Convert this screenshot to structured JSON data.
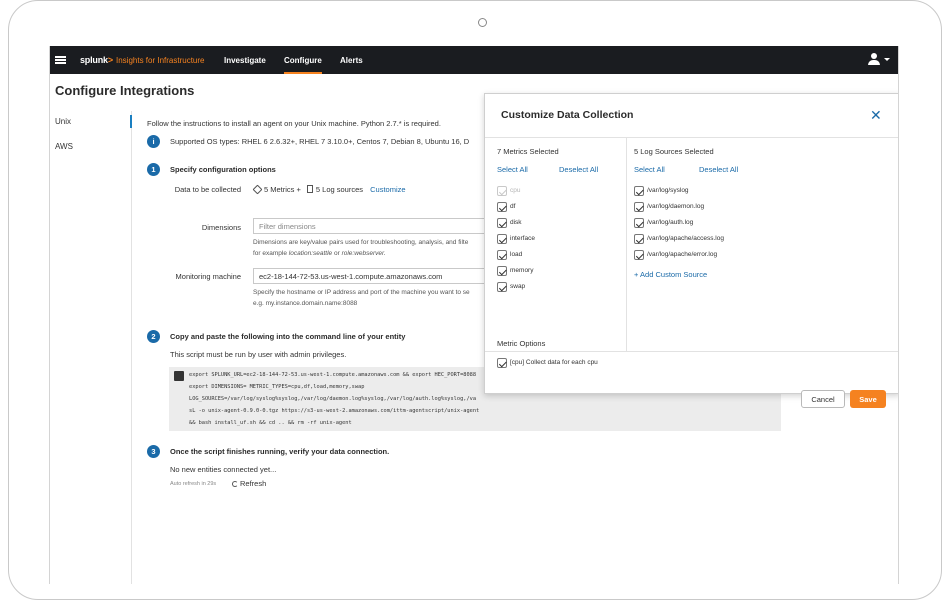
{
  "header": {
    "logo": "splunk",
    "logo_gt": ">",
    "product": "Insights for Infrastructure",
    "nav": [
      {
        "label": "Investigate"
      },
      {
        "label": "Configure"
      },
      {
        "label": "Alerts"
      }
    ],
    "accent": "#f58220"
  },
  "page": {
    "title": "Configure Integrations"
  },
  "sidebar": {
    "items": [
      {
        "label": "Unix"
      },
      {
        "label": "AWS"
      }
    ]
  },
  "main": {
    "instructions": "Follow the instructions to install an agent on your Unix machine. Python 2.7.* is required.",
    "supported": "Supported OS types: RHEL 6 2.6.32+, RHEL 7 3.10.0+, Centos 7, Debian 8, Ubuntu 16, D",
    "step1": {
      "number": "1",
      "title": "Specify configuration options",
      "data_label": "Data to be collected",
      "metrics_summary": "5 Metrics +",
      "logs_summary": "5 Log sources",
      "customize": "Customize",
      "dimensions_label": "Dimensions",
      "dimensions_placeholder": "Filter dimensions",
      "dimensions_help1": "Dimensions are key/value pairs used for troubleshooting, analysis, and filte",
      "dimensions_help2_prefix": "for example ",
      "dimensions_help2_ex1": "location:seattle",
      "dimensions_help2_or": " or ",
      "dimensions_help2_ex2": "role:webserver.",
      "monitoring_label": "Monitoring machine",
      "monitoring_value": "ec2-18-144-72-53.us-west-1.compute.amazonaws.com",
      "monitoring_help1": "Specify the hostname or IP address and port of the machine you want to se",
      "monitoring_help2": "e.g. my.instance.domain.name:8088"
    },
    "step2": {
      "number": "2",
      "title": "Copy and paste the following into the command line of your entity",
      "note": "This script must be run by user with admin privileges.",
      "code": [
        "export SPLUNK_URL=ec2-18-144-72-53.us-west-1.compute.amazonaws.com && export HEC_PORT=8088",
        "export DIMENSIONS= METRIC_TYPES=cpu,df,load,memory,swap",
        "LOG_SOURCES=/var/log/syslog%syslog,/var/log/daemon.log%syslog,/var/log/auth.log%syslog,/va",
        "sL -o unix-agent-0.9.0-0.tgz https://s3-us-west-2.amazonaws.com/ittm-agentscript/unix-agent",
        "&& bash install_uf.sh && cd .. && rm -rf unix-agent"
      ]
    },
    "step3": {
      "number": "3",
      "title": "Once the script finishes running, verify your data connection.",
      "status": "No new entities connected yet...",
      "auto_refresh": "Auto refresh in 29s",
      "refresh": "Refresh"
    }
  },
  "modal": {
    "title": "Customize Data Collection",
    "metrics_header": "7 Metrics Selected",
    "logs_header": "5 Log Sources Selected",
    "select_all": "Select All",
    "deselect_all": "Deselect All",
    "metrics": [
      {
        "label": "cpu",
        "checked": true,
        "disabled": true
      },
      {
        "label": "df",
        "checked": true
      },
      {
        "label": "disk",
        "checked": true
      },
      {
        "label": "interface",
        "checked": true
      },
      {
        "label": "load",
        "checked": true
      },
      {
        "label": "memory",
        "checked": true
      },
      {
        "label": "swap",
        "checked": true
      }
    ],
    "logs": [
      {
        "label": "/var/log/syslog",
        "checked": true
      },
      {
        "label": "/var/log/daemon.log",
        "checked": true
      },
      {
        "label": "/var/log/auth.log",
        "checked": true
      },
      {
        "label": "/var/log/apache/access.log",
        "checked": true
      },
      {
        "label": "/var/log/apache/error.log",
        "checked": true
      }
    ],
    "add_custom_source": "+ Add Custom Source",
    "metric_options_header": "Metric Options",
    "metric_option": "[cpu] Collect data for each cpu",
    "cancel": "Cancel",
    "save": "Save"
  }
}
